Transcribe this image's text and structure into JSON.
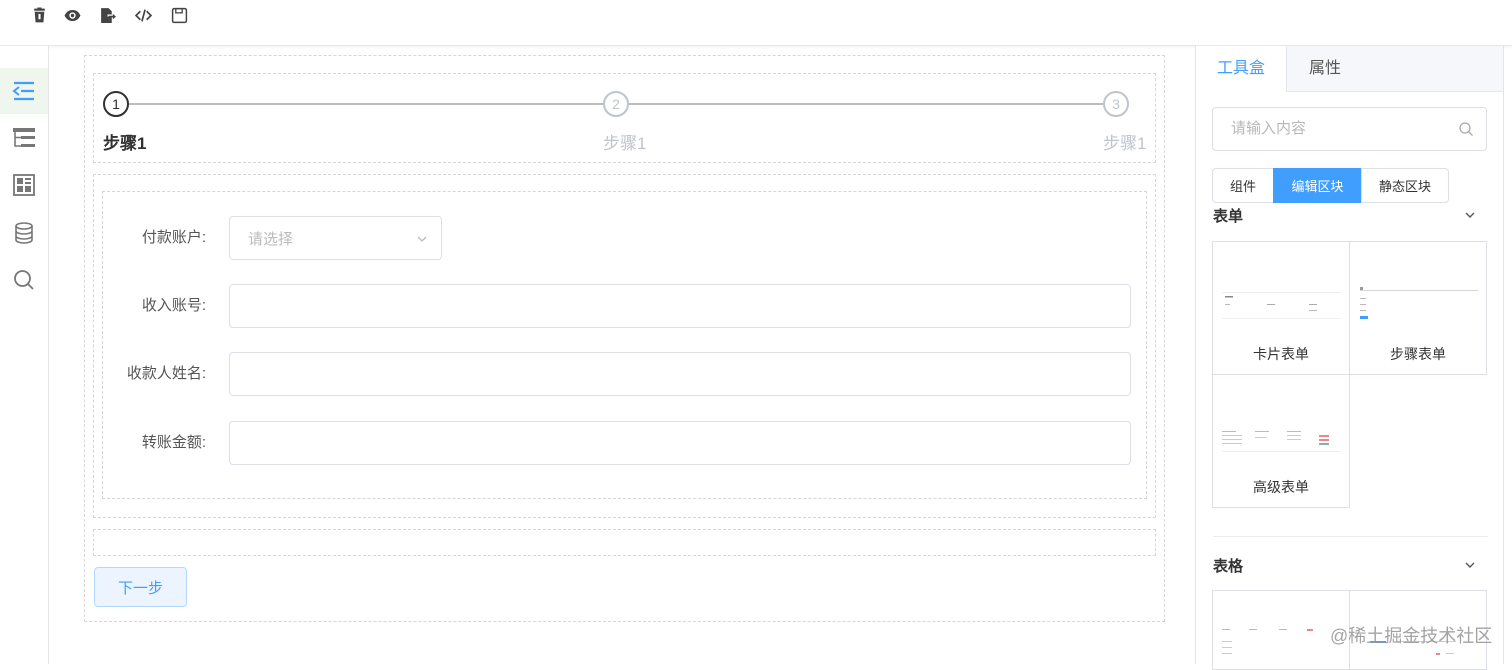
{
  "toolbar": {
    "icons": [
      "delete-icon",
      "preview-eye-icon",
      "export-icon",
      "code-icon",
      "save-icon"
    ]
  },
  "sidebar": {
    "items": [
      {
        "icon": "outline-indent-icon",
        "active": true
      },
      {
        "icon": "tree-structure-icon",
        "active": false
      },
      {
        "icon": "block-layout-icon",
        "active": false
      },
      {
        "icon": "database-icon",
        "active": false
      },
      {
        "icon": "search-icon",
        "active": false
      }
    ]
  },
  "steps": [
    {
      "number": "1",
      "title": "步骤1",
      "active": true
    },
    {
      "number": "2",
      "title": "步骤1",
      "active": false
    },
    {
      "number": "3",
      "title": "步骤1",
      "active": false
    }
  ],
  "form": {
    "fields": [
      {
        "label": "付款账户:",
        "type": "select",
        "placeholder": "请选择"
      },
      {
        "label": "收入账号:",
        "type": "text",
        "value": ""
      },
      {
        "label": "收款人姓名:",
        "type": "text",
        "value": ""
      },
      {
        "label": "转账金额:",
        "type": "text",
        "value": ""
      }
    ],
    "next_button": "下一步"
  },
  "right_panel": {
    "tabs": [
      {
        "label": "工具盒",
        "active": true
      },
      {
        "label": "属性",
        "active": false
      }
    ],
    "search_placeholder": "请输入内容",
    "segments": [
      {
        "label": "组件",
        "active": false
      },
      {
        "label": "编辑区块",
        "active": true
      },
      {
        "label": "静态区块",
        "active": false
      }
    ],
    "categories": [
      {
        "title": "表单",
        "cards": [
          "卡片表单",
          "步骤表单",
          "高级表单"
        ]
      },
      {
        "title": "表格",
        "cards": [
          "",
          ""
        ]
      }
    ]
  },
  "watermark": "@稀土掘金技术社区",
  "colors": {
    "accent": "#409eff",
    "accent_light": "#ecf5ff",
    "sidebar_active": "#eef6ee"
  }
}
